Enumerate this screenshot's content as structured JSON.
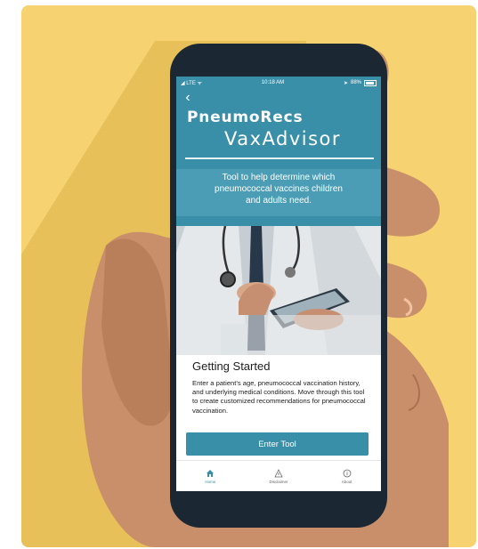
{
  "status_bar": {
    "carrier": "LTE",
    "time": "10:18 AM",
    "battery": "88%"
  },
  "header": {
    "app_name": "PneumoRecs",
    "app_sub": "VaxAdvisor",
    "tagline": "Tool to help determine which pneumococcal vaccines children and adults need."
  },
  "info": {
    "title": "Getting Started",
    "body": "Enter a patient's age, pneumococcal vaccination history, and underlying medical conditions. Move through this tool to create customized recommendations for pneumococcal vaccination.",
    "button": "Enter Tool"
  },
  "tabs": [
    {
      "label": "Home",
      "icon": "home-icon",
      "active": true
    },
    {
      "label": "Disclaimer",
      "icon": "warning-icon",
      "active": false
    },
    {
      "label": "About",
      "icon": "info-icon",
      "active": false
    }
  ],
  "colors": {
    "brand": "#3a8fa8",
    "background": "#f6d270",
    "phone": "#1b2833"
  },
  "icons": [
    "back-chevron-icon",
    "signal-icon",
    "wifi-icon",
    "battery-icon",
    "stethoscope-icon",
    "tablet-icon"
  ]
}
